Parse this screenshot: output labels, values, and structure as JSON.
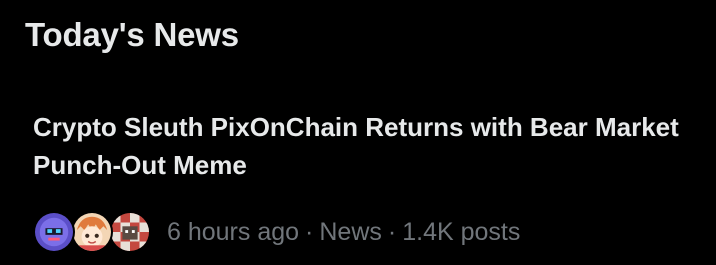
{
  "section": {
    "title": "Today's News"
  },
  "news_item": {
    "headline": "Crypto Sleuth PixOnChain Returns with Bear Market Punch-Out Meme",
    "time": "6 hours ago",
    "category": "News",
    "posts": "1.4K posts",
    "separator": "·",
    "avatars": [
      {
        "icon": "pixel-robot-avatar-icon",
        "bg": "#5b4fc8"
      },
      {
        "icon": "anime-character-avatar-icon",
        "bg": "#f3d6b5"
      },
      {
        "icon": "pixel-art-avatar-icon",
        "bg": "#c4483f"
      }
    ]
  },
  "colors": {
    "background": "#000000",
    "text_primary": "#e7e9ea",
    "text_secondary": "#71767b"
  }
}
